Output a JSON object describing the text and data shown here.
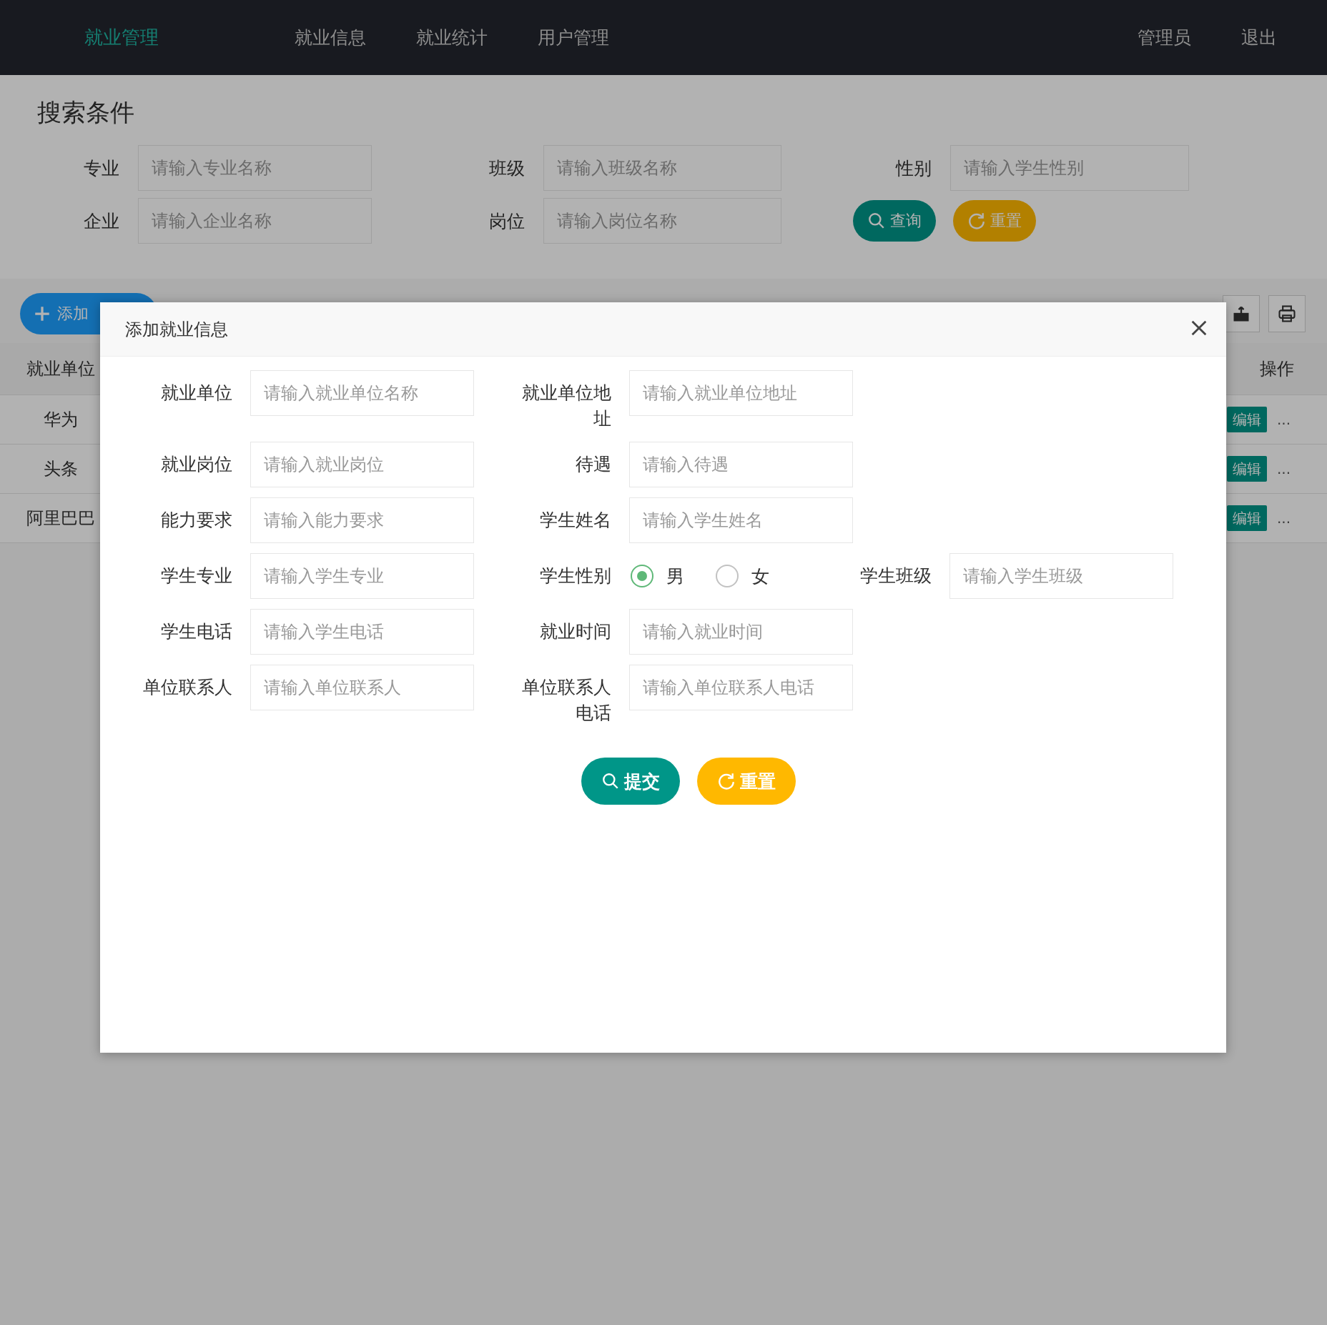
{
  "navbar": {
    "brand": "就业管理",
    "links": [
      {
        "label": "就业信息"
      },
      {
        "label": "就业统计"
      },
      {
        "label": "用户管理"
      }
    ],
    "user": "管理员",
    "logout": "退出"
  },
  "search": {
    "title": "搜索条件",
    "fields": [
      {
        "label": "专业",
        "placeholder": "请输入专业名称"
      },
      {
        "label": "班级",
        "placeholder": "请输入班级名称"
      },
      {
        "label": "性别",
        "placeholder": "请输入学生性别"
      },
      {
        "label": "企业",
        "placeholder": "请输入企业名称"
      },
      {
        "label": "岗位",
        "placeholder": "请输入岗位名称"
      }
    ],
    "buttons": [
      {
        "kind": "search",
        "label": "查询"
      },
      {
        "kind": "reset",
        "label": "重置"
      }
    ]
  },
  "toolbar": {
    "add_button": "添加",
    "tools": [
      {
        "kind": "export"
      },
      {
        "kind": "print"
      }
    ]
  },
  "table": {
    "columns": [
      {
        "label": "就业单位"
      },
      {
        "label": "操作"
      }
    ],
    "rows": [
      {
        "company": "华为",
        "edit": "编辑",
        "more": "..."
      },
      {
        "company": "头条",
        "edit": "编辑",
        "more": "..."
      },
      {
        "company": "阿里巴巴",
        "edit": "编辑",
        "more": "..."
      }
    ]
  },
  "dialog": {
    "title": "添加就业信息",
    "rows": [
      [
        {
          "kind": "text",
          "label": "就业单位",
          "placeholder": "请输入就业单位名称"
        },
        {
          "kind": "text",
          "label": "就业单位地址",
          "placeholder": "请输入就业单位地址"
        }
      ],
      [
        {
          "kind": "text",
          "label": "就业岗位",
          "placeholder": "请输入就业岗位"
        },
        {
          "kind": "text",
          "label": "待遇",
          "placeholder": "请输入待遇"
        }
      ],
      [
        {
          "kind": "text",
          "label": "能力要求",
          "placeholder": "请输入能力要求"
        },
        {
          "kind": "text",
          "label": "学生姓名",
          "placeholder": "请输入学生姓名"
        }
      ],
      [
        {
          "kind": "text",
          "label": "学生专业",
          "placeholder": "请输入学生专业"
        },
        {
          "kind": "radio",
          "label": "学生性别",
          "options": [
            {
              "label": "男",
              "selected": true
            },
            {
              "label": "女",
              "selected": false
            }
          ]
        },
        {
          "kind": "text",
          "label": "学生班级",
          "placeholder": "请输入学生班级"
        }
      ],
      [
        {
          "kind": "text",
          "label": "学生电话",
          "placeholder": "请输入学生电话"
        },
        {
          "kind": "text",
          "label": "就业时间",
          "placeholder": "请输入就业时间"
        }
      ],
      [
        {
          "kind": "text",
          "label": "单位联系人",
          "placeholder": "请输入单位联系人"
        },
        {
          "kind": "text",
          "label": "单位联系人电话",
          "placeholder": "请输入单位联系人电话"
        }
      ]
    ],
    "buttons": [
      {
        "kind": "submit",
        "label": "提交"
      },
      {
        "kind": "reset",
        "label": "重置"
      }
    ]
  }
}
